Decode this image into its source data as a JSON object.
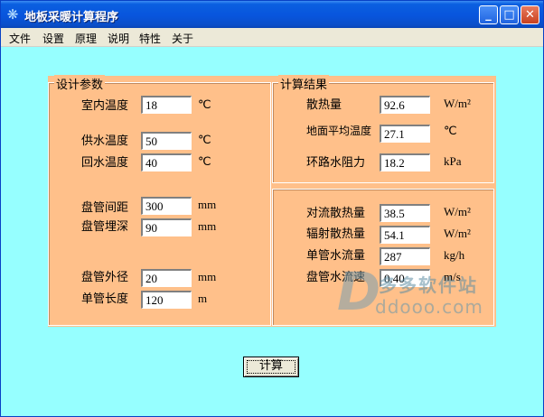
{
  "window": {
    "title": "地板采暖计算程序",
    "minimize_label": "_",
    "maximize_label": "□",
    "close_label": "✕"
  },
  "menu": [
    "文件",
    "设置",
    "原理",
    "说明",
    "特性",
    "关于"
  ],
  "design_params": {
    "title": "设计参数",
    "room_temp": {
      "label": "室内温度",
      "value": "18",
      "unit": "℃"
    },
    "supply_temp": {
      "label": "供水温度",
      "value": "50",
      "unit": "℃"
    },
    "return_temp": {
      "label": "回水温度",
      "value": "40",
      "unit": "℃"
    },
    "pipe_spacing": {
      "label": "盘管间距",
      "value": "300",
      "unit": "mm"
    },
    "pipe_depth": {
      "label": "盘管埋深",
      "value": "90",
      "unit": "mm"
    },
    "pipe_od": {
      "label": "盘管外径",
      "value": "20",
      "unit": "mm"
    },
    "pipe_length": {
      "label": "单管长度",
      "value": "120",
      "unit": "m"
    }
  },
  "results": {
    "title": "计算结果",
    "heat_dissipation": {
      "label": "散热量",
      "value": "92.6",
      "unit": "W/m²"
    },
    "floor_avg_temp": {
      "label": "地面平均温度",
      "value": "27.1",
      "unit": "℃"
    },
    "loop_resistance": {
      "label": "环路水阻力",
      "value": "18.2",
      "unit": "kPa"
    },
    "convective_heat": {
      "label": "对流散热量",
      "value": "38.5",
      "unit": "W/m²"
    },
    "radiant_heat": {
      "label": "辐射散热量",
      "value": "54.1",
      "unit": "W/m²"
    },
    "pipe_flow": {
      "label": "单管水流量",
      "value": "287",
      "unit": "kg/h"
    },
    "pipe_velocity": {
      "label": "盘管水流速",
      "value": "0.40",
      "unit": "m/s"
    }
  },
  "calculate_button": "计算",
  "watermark": {
    "logo": "D",
    "name": "多多软件站",
    "url": "ddooo.com"
  }
}
